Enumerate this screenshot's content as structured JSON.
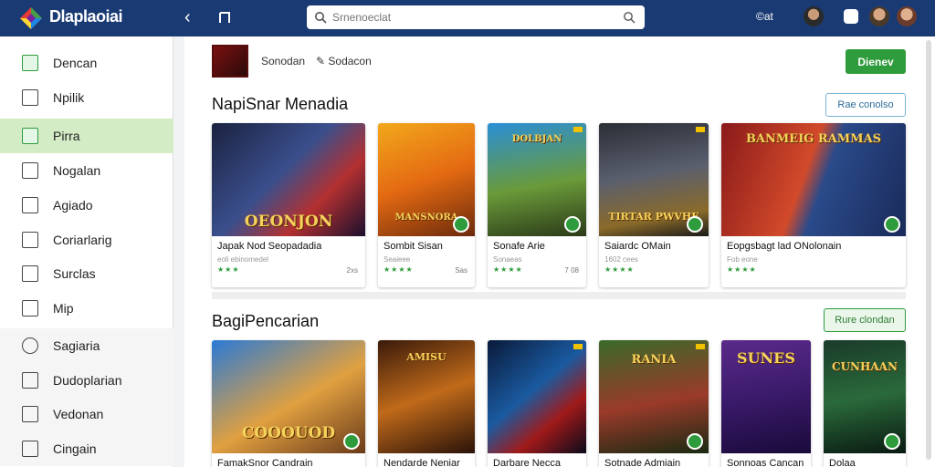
{
  "app": {
    "title": "Dlaplaoiai"
  },
  "search": {
    "placeholder": "Srnenoeclat"
  },
  "topbar": {
    "right_text": "©at"
  },
  "sidebar": {
    "items": [
      {
        "label": "Dencan",
        "icon": "chart-icon"
      },
      {
        "label": "Npilik",
        "icon": "document-icon"
      },
      {
        "label": "Pirra",
        "icon": "grid-icon"
      },
      {
        "label": "Nogalan",
        "icon": "shield-icon"
      },
      {
        "label": "Agiado",
        "icon": "edit-icon"
      },
      {
        "label": "Coriarlarig",
        "icon": "list-icon"
      },
      {
        "label": "Surclas",
        "icon": "box-icon"
      },
      {
        "label": "Mip",
        "icon": "table-icon"
      },
      {
        "label": "Sagiaria",
        "icon": "circle-icon"
      },
      {
        "label": "Dudoplarian",
        "icon": "folder-icon"
      },
      {
        "label": "Vedonan",
        "icon": "page-icon"
      },
      {
        "label": "Cingain",
        "icon": "user-icon"
      }
    ],
    "active_index": 2
  },
  "developer": {
    "name": "Sonodan",
    "link": "Sodacon"
  },
  "install": {
    "label": "Dienev"
  },
  "section1": {
    "title": "NapiSnar Menadia",
    "button": "Rae conolso",
    "cards": [
      {
        "title": "Japak Nod Seopadadia",
        "sub": "eoli ebinomedel",
        "stars": "★★★",
        "size": "2xs",
        "art_text": "OEONJON"
      },
      {
        "title": "Sombit Sisan",
        "sub": "Seaieee",
        "stars": "★★★★",
        "size": "Sas",
        "art_text": "MANSNORA"
      },
      {
        "title": "Sonafe Arie",
        "sub": "Sonaeas",
        "stars": "★★★★",
        "size": "7 08",
        "art_text": "DOLBJAN"
      },
      {
        "title": "Saiardc OMain",
        "sub": "1602 cees",
        "stars": "★★★★",
        "size": "",
        "art_text": "TIRTAR PWVHE"
      },
      {
        "title": "Eopgsbagt lad ONolonain",
        "sub": "Fob eone",
        "stars": "★★★★",
        "size": "",
        "art_text": "BANMEIG RAMMAS"
      }
    ]
  },
  "section2": {
    "title": "BagiPencarian",
    "button": "Rure clondan",
    "cards": [
      {
        "title": "FamakSnor Candrain",
        "art_text": "COOOUOD"
      },
      {
        "title": "Nendarde Neniar",
        "art_text": "AMISU"
      },
      {
        "title": "Darbare Necca",
        "art_text": ""
      },
      {
        "title": "Sotnade Admiain",
        "art_text": "RANIA"
      },
      {
        "title": "Sonnoas Cancan",
        "art_text": "SUNES"
      },
      {
        "title": "Dolaa",
        "art_text": "CUNHAAN"
      }
    ]
  },
  "colors": {
    "topbar": "#1a3a73",
    "accent": "#2e9b3c",
    "active": "#d4ecc6"
  }
}
